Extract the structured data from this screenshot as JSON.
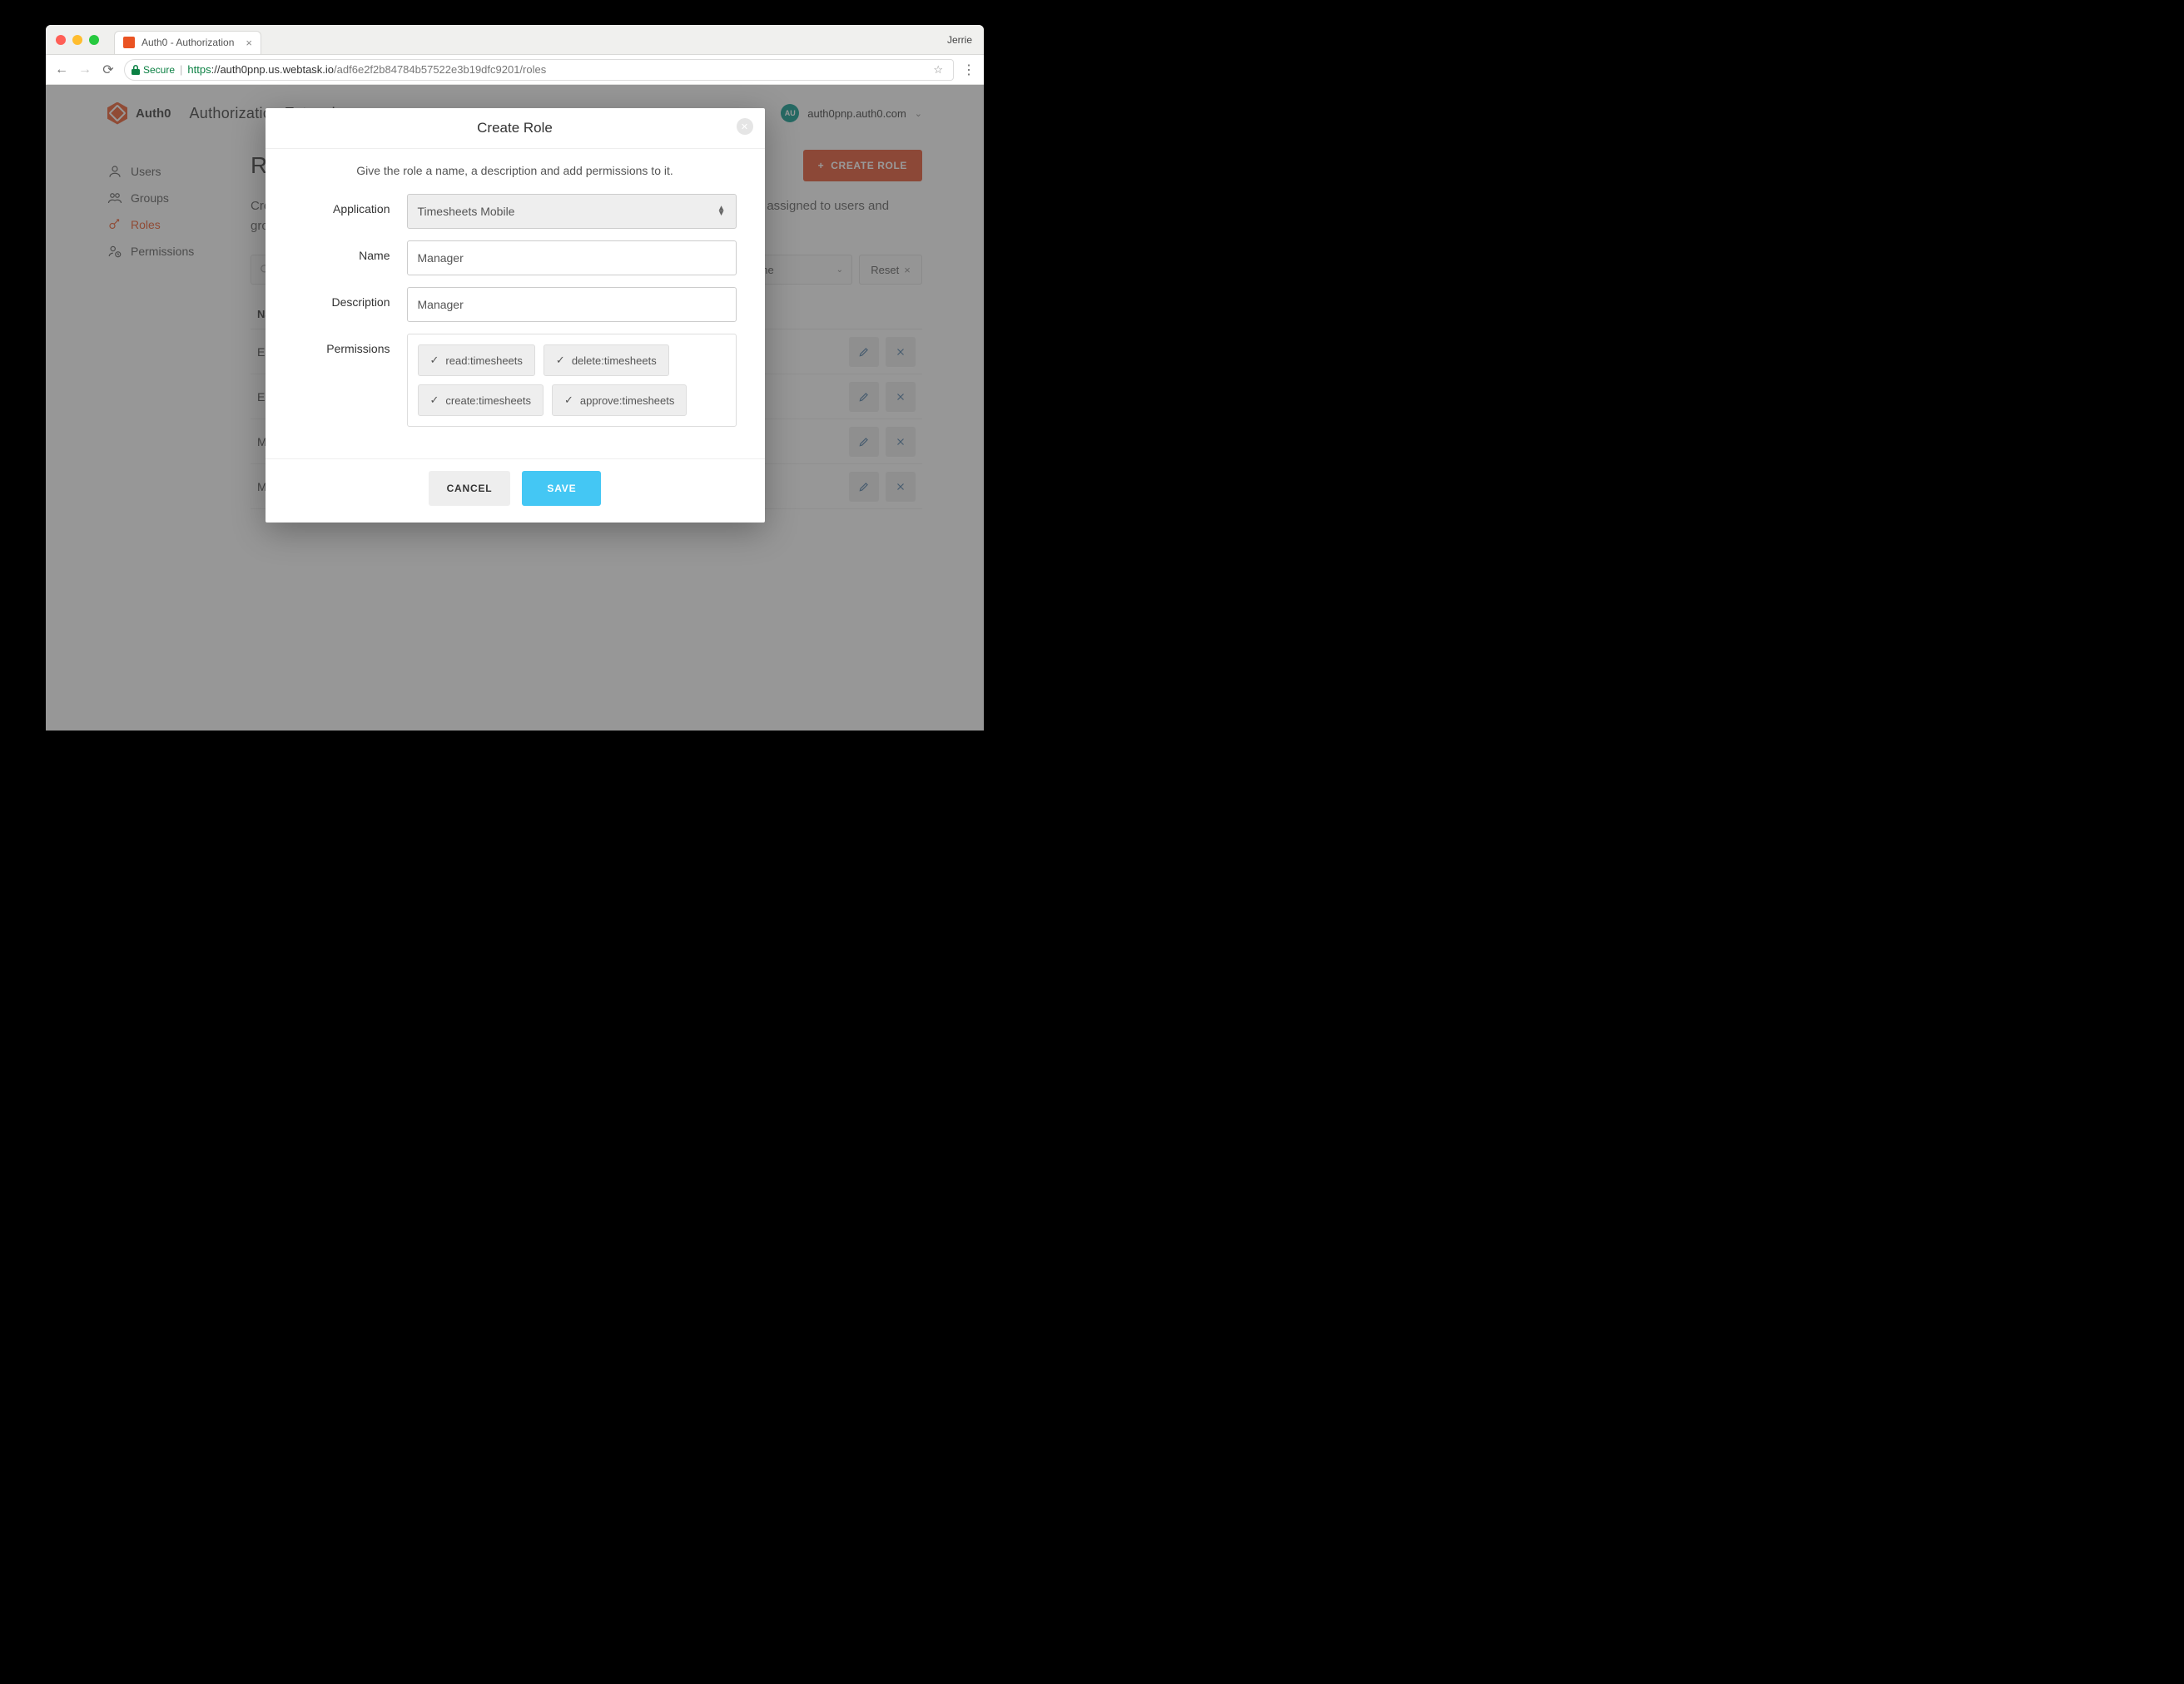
{
  "browser": {
    "tab_title": "Auth0 - Authorization",
    "profile_name": "Jerrie",
    "secure_label": "Secure",
    "url_proto": "https",
    "url_host": "://auth0pnp.us.webtask.io",
    "url_path": "/adf6e2f2b84784b57522e3b19dfc9201/roles"
  },
  "header": {
    "brand_name": "Auth0",
    "app_title": "Authorization Extension",
    "account_domain": "auth0pnp.auth0.com",
    "avatar_initials": "AU"
  },
  "sidebar": {
    "items": [
      {
        "label": "Users",
        "icon": "users-icon"
      },
      {
        "label": "Groups",
        "icon": "groups-icon"
      },
      {
        "label": "Roles",
        "icon": "roles-icon"
      },
      {
        "label": "Permissions",
        "icon": "permissions-icon"
      }
    ]
  },
  "page": {
    "title": "Roles",
    "create_button": "CREATE ROLE",
    "description": "Create and manage Roles (collection of permissions) for your applications which can then be assigned to users and groups.",
    "filter_label": "Name",
    "reset_label": "Reset",
    "table_header": "Name",
    "rows": [
      {
        "name": "Employee"
      },
      {
        "name": "Employee"
      },
      {
        "name": "Manager"
      },
      {
        "name": "Manager"
      }
    ]
  },
  "modal": {
    "title": "Create Role",
    "subtitle": "Give the role a name, a description and add permissions to it.",
    "fields": {
      "application_label": "Application",
      "application_value": "Timesheets Mobile",
      "name_label": "Name",
      "name_value": "Manager",
      "description_label": "Description",
      "description_value": "Manager",
      "permissions_label": "Permissions"
    },
    "permissions": [
      "read:timesheets",
      "delete:timesheets",
      "create:timesheets",
      "approve:timesheets"
    ],
    "cancel_label": "CANCEL",
    "save_label": "SAVE"
  }
}
